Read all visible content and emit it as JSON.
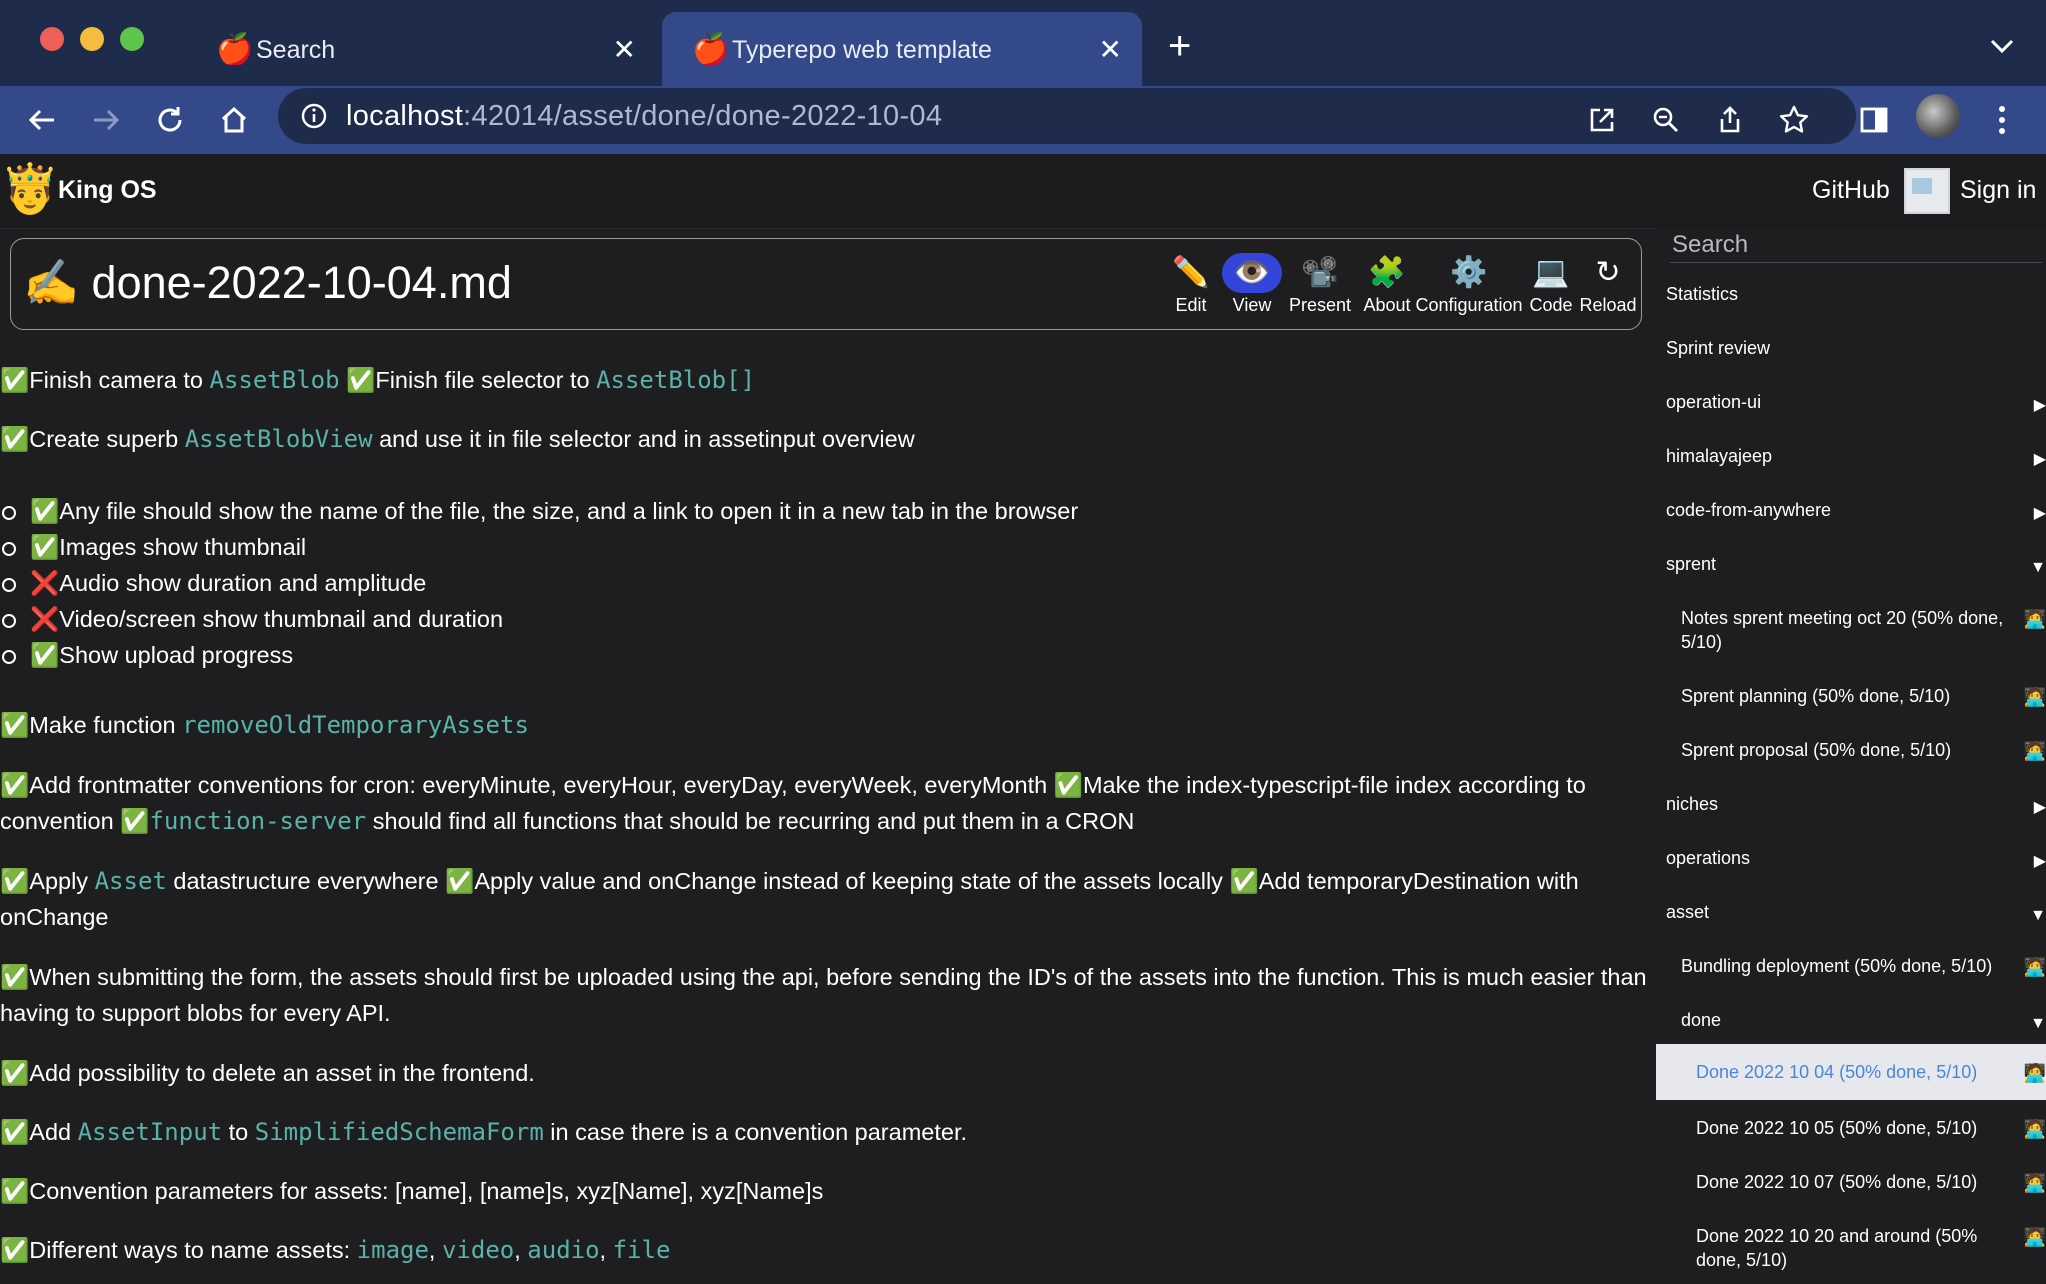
{
  "browser": {
    "tabs": [
      {
        "title": "Search",
        "favicon": "🍎"
      },
      {
        "title": "Typerepo web template",
        "favicon": "🍎"
      }
    ],
    "url_host": "localhost",
    "url_rest": ":42014/asset/done/done-2022-10-04",
    "colors": {
      "tabstrip": "#1f2b4a",
      "toolbar": "#34498a",
      "omnibox": "#1f2b4a"
    }
  },
  "app": {
    "logo": "🤴",
    "brand": "King OS",
    "github": "GitHub",
    "sign_in": "Sign in"
  },
  "document": {
    "title_emoji": "✍️",
    "title": "done-2022-10-04.md",
    "actions": [
      {
        "icon": "pencil-icon",
        "glyph": "✏️",
        "label": "Edit"
      },
      {
        "icon": "eye-icon",
        "glyph": "👁️",
        "label": "View",
        "active": true
      },
      {
        "icon": "projector-icon",
        "glyph": "📽️",
        "label": "Present"
      },
      {
        "icon": "puzzle-icon",
        "glyph": "🧩",
        "label": "About"
      },
      {
        "icon": "gear-icon",
        "glyph": "⚙️",
        "label": "Configuration"
      },
      {
        "icon": "laptop-icon",
        "glyph": "💻",
        "label": "Code"
      },
      {
        "icon": "reload-icon",
        "glyph": "↻",
        "label": "Reload"
      }
    ]
  },
  "content": {
    "p1": {
      "a": "Finish camera to ",
      "code1": "AssetBlob",
      "b": "Finish file selector to ",
      "code2": "AssetBlob[]"
    },
    "p2": {
      "a": "Create superb ",
      "code1": "AssetBlobView",
      "b": " and use it in file selector and in assetinput overview"
    },
    "list": [
      {
        "status": "done",
        "text": "Any file should show the name of the file, the size, and a link to open it in a new tab in the browser"
      },
      {
        "status": "done",
        "text": "Images show thumbnail"
      },
      {
        "status": "todo",
        "text": "Audio show duration and amplitude"
      },
      {
        "status": "todo",
        "text": "Video/screen show thumbnail and duration"
      },
      {
        "status": "done",
        "text": "Show upload progress"
      }
    ],
    "p3": {
      "a": "Make function ",
      "code1": "removeOldTemporaryAssets"
    },
    "p4": {
      "a": "Add frontmatter conventions for cron: everyMinute, everyHour, everyDay, everyWeek, everyMonth ",
      "b": "Make the index-typescript-file index according to convention ",
      "code1": "function-server",
      "c": " should find all functions that should be recurring and put them in a CRON"
    },
    "p5": {
      "a": "Apply ",
      "code1": "Asset",
      "b": " datastructure everywhere ",
      "c": "Apply value and onChange instead of keeping state of the assets locally ",
      "d": "Add temporaryDestination with onChange"
    },
    "p6": {
      "a": "When submitting the form, the assets should first be uploaded using the api, before sending the ID's of the assets into the function. This is much easier than having to support blobs for every API."
    },
    "p7": {
      "a": "Add possibility to delete an asset in the frontend."
    },
    "p8": {
      "a": "Add ",
      "code1": "AssetInput",
      "b": " to ",
      "code2": "SimplifiedSchemaForm",
      "c": " in case there is a convention parameter."
    },
    "p9": {
      "a": "Convention parameters for assets: [name], [name]s, xyz[Name], xyz[Name]s"
    },
    "p10": {
      "a": "Different ways to name assets: ",
      "code1": "image",
      "sep1": ", ",
      "code2": "video",
      "sep2": ", ",
      "code3": "audio",
      "sep3": ", ",
      "code4": "file"
    },
    "done_mark": "✅",
    "todo_mark": "❌"
  },
  "sidebar": {
    "search_placeholder": "Search",
    "items": [
      {
        "label": "Statistics",
        "level": 0
      },
      {
        "label": "Sprint review",
        "level": 0
      },
      {
        "label": "operation-ui",
        "level": 0,
        "toggle": "▶"
      },
      {
        "label": "himalayajeep",
        "level": 0,
        "toggle": "▶"
      },
      {
        "label": "code-from-anywhere",
        "level": 0,
        "toggle": "▶"
      },
      {
        "label": "sprent",
        "level": 0,
        "toggle": "▼"
      },
      {
        "label": "Notes sprent meeting oct 20 (50% done, 5/10)",
        "level": 1,
        "emoji": "🧑‍💻"
      },
      {
        "label": "Sprent planning (50% done, 5/10)",
        "level": 1,
        "emoji": "🧑‍💻"
      },
      {
        "label": "Sprent proposal (50% done, 5/10)",
        "level": 1,
        "emoji": "🧑‍💻"
      },
      {
        "label": "niches",
        "level": 0,
        "toggle": "▶"
      },
      {
        "label": "operations",
        "level": 0,
        "toggle": "▶"
      },
      {
        "label": "asset",
        "level": 0,
        "toggle": "▼"
      },
      {
        "label": "Bundling deployment (50% done, 5/10)",
        "level": 1,
        "emoji": "🧑‍💻"
      },
      {
        "label": "done",
        "level": 1,
        "toggle": "▼"
      },
      {
        "label": "Done 2022 10 04 (50% done, 5/10)",
        "level": 2,
        "emoji": "🧑‍💻",
        "active": true
      },
      {
        "label": "Done 2022 10 05 (50% done, 5/10)",
        "level": 2,
        "emoji": "🧑‍💻"
      },
      {
        "label": "Done 2022 10 07 (50% done, 5/10)",
        "level": 2,
        "emoji": "🧑‍💻"
      },
      {
        "label": "Done 2022 10 20 and around (50% done, 5/10)",
        "level": 2,
        "emoji": "🧑‍💻"
      }
    ]
  }
}
